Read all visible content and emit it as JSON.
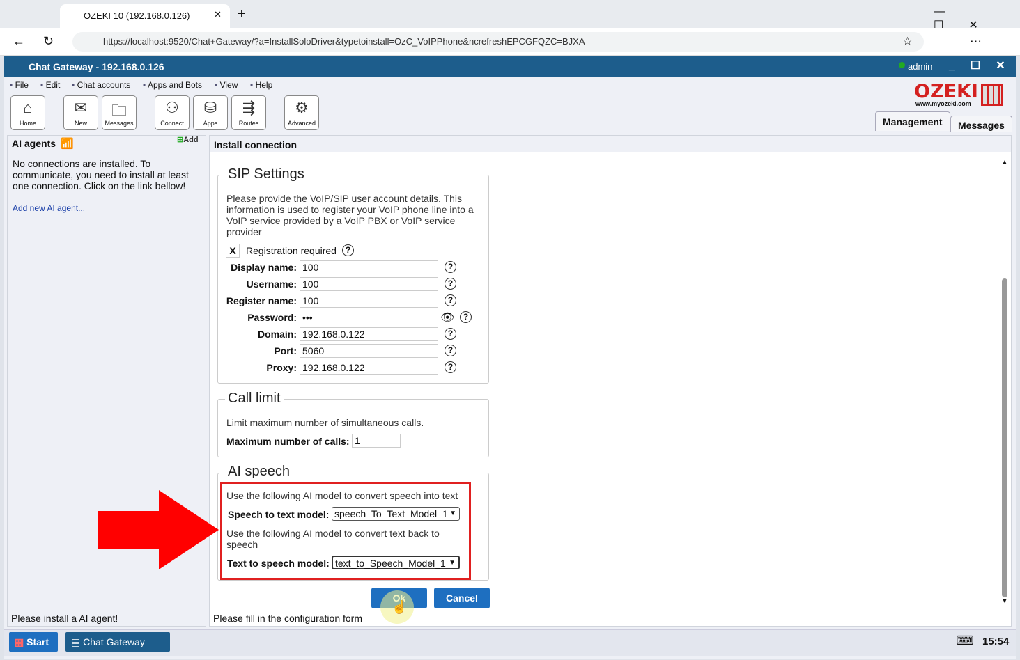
{
  "browser": {
    "tab_title": "OZEKI 10 (192.168.0.126)",
    "url": "https://localhost:9520/Chat+Gateway/?a=InstallSoloDriver&typetoinstall=OzC_VoIPPhone&ncrefreshEPCGFQZC=BJXA"
  },
  "app": {
    "title": "Chat Gateway - 192.168.0.126",
    "user": "admin",
    "logo": "OZEKI",
    "logo_url": "www.myozeki.com"
  },
  "menu": [
    "File",
    "Edit",
    "Chat accounts",
    "Apps and Bots",
    "View",
    "Help"
  ],
  "toolbar": [
    "Home",
    "New",
    "Messages",
    "Connect",
    "Apps",
    "Routes",
    "Advanced"
  ],
  "tabs": [
    "Management",
    "Messages"
  ],
  "left": {
    "title": "AI agents",
    "add": "Add",
    "message": "No connections are installed. To communicate, you need to install at least one connection. Click on the link bellow!",
    "link": "Add new AI agent...",
    "status": "Please install a AI agent!"
  },
  "right": {
    "title": "Install connection",
    "status": "Please fill in the configuration form"
  },
  "sip": {
    "legend": "SIP Settings",
    "desc": "Please provide the VoIP/SIP user account details. This information is used to register your VoIP phone line into a VoIP service provided by a VoIP PBX or VoIP service provider",
    "reg_check": "X",
    "reg_label": "Registration required",
    "fields": [
      {
        "label": "Display name:",
        "value": "100"
      },
      {
        "label": "Username:",
        "value": "100"
      },
      {
        "label": "Register name:",
        "value": "100"
      },
      {
        "label": "Password:",
        "value": "•••"
      },
      {
        "label": "Domain:",
        "value": "192.168.0.122"
      },
      {
        "label": "Port:",
        "value": "5060"
      },
      {
        "label": "Proxy:",
        "value": "192.168.0.122"
      }
    ]
  },
  "call_limit": {
    "legend": "Call limit",
    "desc": "Limit maximum number of simultaneous calls.",
    "label": "Maximum number of calls:",
    "value": "1"
  },
  "ai_speech": {
    "legend": "AI speech",
    "stt_desc": "Use the following AI model to convert speech into text",
    "stt_label": "Speech to text model:",
    "stt_value": "speech_To_Text_Model_1",
    "tts_desc": "Use the following AI model to convert text back to speech",
    "tts_label": "Text to speech model:",
    "tts_value": "text_to_Speech_Model_1"
  },
  "buttons": {
    "ok": "Ok",
    "cancel": "Cancel"
  },
  "taskbar": {
    "start": "Start",
    "app": "Chat Gateway",
    "time": "15:54"
  },
  "colors": {
    "titlebar": "#1d5d8c",
    "highlight": "#e02020",
    "button": "#1e6fc0"
  }
}
